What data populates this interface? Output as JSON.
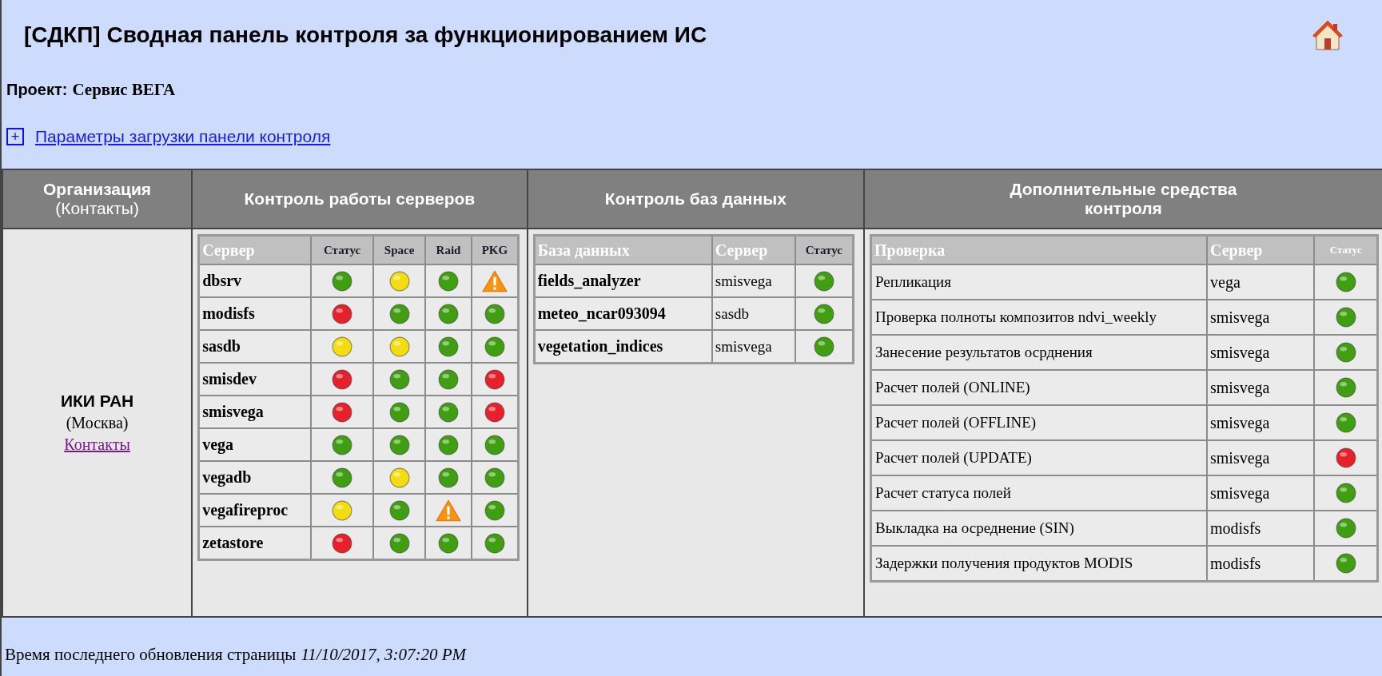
{
  "title": "[СДКП] Сводная панель контроля за функционированием ИС",
  "project": {
    "label": "Проект:",
    "value": "Сервис ВЕГА"
  },
  "params_link": {
    "toggle": "+",
    "label": "Параметры загрузки панели контроля"
  },
  "columns": [
    {
      "title": "Организация",
      "subtitle": "(Контакты)"
    },
    {
      "title": "Контроль работы серверов"
    },
    {
      "title": "Контроль баз данных"
    },
    {
      "title": "Дополнительные средства контроля"
    }
  ],
  "organization": {
    "name": "ИКИ РАН",
    "city": "(Москва)",
    "contacts_link": "Контакты"
  },
  "servers": {
    "columns": [
      "Сервер",
      "Статус",
      "Space",
      "Raid",
      "PKG"
    ],
    "rows": [
      {
        "name": "dbsrv",
        "checks": [
          {
            "kind": "dot",
            "color": "#3f9f10"
          },
          {
            "kind": "dot",
            "color": "#f5dc10"
          },
          {
            "kind": "dot",
            "color": "#3f9f10"
          },
          {
            "kind": "warning"
          }
        ]
      },
      {
        "name": "modisfs",
        "checks": [
          {
            "kind": "dot",
            "color": "#e8202a"
          },
          {
            "kind": "dot",
            "color": "#3f9f10"
          },
          {
            "kind": "dot",
            "color": "#3f9f10"
          },
          {
            "kind": "dot",
            "color": "#3f9f10"
          }
        ]
      },
      {
        "name": "sasdb",
        "checks": [
          {
            "kind": "dot",
            "color": "#f5dc10"
          },
          {
            "kind": "dot",
            "color": "#f5dc10"
          },
          {
            "kind": "dot",
            "color": "#3f9f10"
          },
          {
            "kind": "dot",
            "color": "#3f9f10"
          }
        ]
      },
      {
        "name": "smisdev",
        "checks": [
          {
            "kind": "dot",
            "color": "#e8202a"
          },
          {
            "kind": "dot",
            "color": "#3f9f10"
          },
          {
            "kind": "dot",
            "color": "#3f9f10"
          },
          {
            "kind": "dot",
            "color": "#e8202a"
          }
        ]
      },
      {
        "name": "smisvega",
        "checks": [
          {
            "kind": "dot",
            "color": "#e8202a"
          },
          {
            "kind": "dot",
            "color": "#3f9f10"
          },
          {
            "kind": "dot",
            "color": "#3f9f10"
          },
          {
            "kind": "dot",
            "color": "#e8202a"
          }
        ]
      },
      {
        "name": "vega",
        "checks": [
          {
            "kind": "dot",
            "color": "#3f9f10"
          },
          {
            "kind": "dot",
            "color": "#3f9f10"
          },
          {
            "kind": "dot",
            "color": "#3f9f10"
          },
          {
            "kind": "dot",
            "color": "#3f9f10"
          }
        ]
      },
      {
        "name": "vegadb",
        "checks": [
          {
            "kind": "dot",
            "color": "#3f9f10"
          },
          {
            "kind": "dot",
            "color": "#f5dc10"
          },
          {
            "kind": "dot",
            "color": "#3f9f10"
          },
          {
            "kind": "dot",
            "color": "#3f9f10"
          }
        ]
      },
      {
        "name": "vegafireproc",
        "checks": [
          {
            "kind": "dot",
            "color": "#f5dc10"
          },
          {
            "kind": "dot",
            "color": "#3f9f10"
          },
          {
            "kind": "warning"
          },
          {
            "kind": "dot",
            "color": "#3f9f10"
          }
        ]
      },
      {
        "name": "zetastore",
        "checks": [
          {
            "kind": "dot",
            "color": "#e8202a"
          },
          {
            "kind": "dot",
            "color": "#3f9f10"
          },
          {
            "kind": "dot",
            "color": "#3f9f10"
          },
          {
            "kind": "dot",
            "color": "#3f9f10"
          }
        ]
      }
    ]
  },
  "databases": {
    "columns": [
      "База данных",
      "Сервер",
      "Статус"
    ],
    "rows": [
      {
        "name": "fields_analyzer",
        "server": "smisvega",
        "color": "#3f9f10"
      },
      {
        "name": "meteo_ncar093094",
        "server": "sasdb",
        "color": "#3f9f10"
      },
      {
        "name": "vegetation_indices",
        "server": "smisvega",
        "color": "#3f9f10"
      }
    ]
  },
  "extra_checks": {
    "columns": [
      "Проверка",
      "Сервер",
      "Статус"
    ],
    "rows": [
      {
        "name": "Репликация",
        "server": "vega",
        "color": "#3f9f10"
      },
      {
        "name": "Проверка полноты композитов ndvi_weekly",
        "server": "smisvega",
        "color": "#3f9f10"
      },
      {
        "name": "Занесение результатов осрднения",
        "server": "smisvega",
        "color": "#3f9f10"
      },
      {
        "name": "Расчет полей (ONLINE)",
        "server": "smisvega",
        "color": "#3f9f10"
      },
      {
        "name": "Расчет полей (OFFLINE)",
        "server": "smisvega",
        "color": "#3f9f10"
      },
      {
        "name": "Расчет полей (UPDATE)",
        "server": "smisvega",
        "color": "#e8202a"
      },
      {
        "name": "Расчет статуса полей",
        "server": "smisvega",
        "color": "#3f9f10"
      },
      {
        "name": "Выкладка на осреднение (SIN)",
        "server": "modisfs",
        "color": "#3f9f10"
      },
      {
        "name": "Задержки получения продуктов MODIS",
        "server": "modisfs",
        "color": "#3f9f10"
      }
    ]
  },
  "footer": {
    "label": "Время последнего обновления страницы",
    "timestamp": "11/10/2017, 3:07:20 PM"
  }
}
